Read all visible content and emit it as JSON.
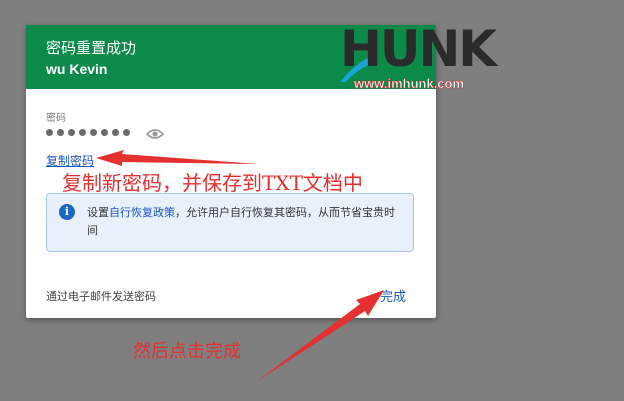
{
  "dialog": {
    "title": "密码重置成功",
    "user_name": "wu Kevin",
    "password_label": "密码",
    "password_mask_count": 8,
    "copy_link": "复制密码",
    "info": {
      "prefix": "设置",
      "link": "自行恢复政策",
      "suffix": "，允许用户自行恢复其密码，从而节省宝贵时间"
    },
    "email_link": "通过电子邮件发送密码",
    "done_button": "完成"
  },
  "watermark": {
    "brand": "HUNK",
    "url": "www.imhunk.com"
  },
  "annotations": {
    "copy_note": "复制新密码，并保存到TXT文档中",
    "done_note": "然后点击完成"
  },
  "colors": {
    "header": "#0b8a4a",
    "link": "#1a56c4",
    "annotation": "#e53030",
    "overlay": "#7f7f7f"
  }
}
